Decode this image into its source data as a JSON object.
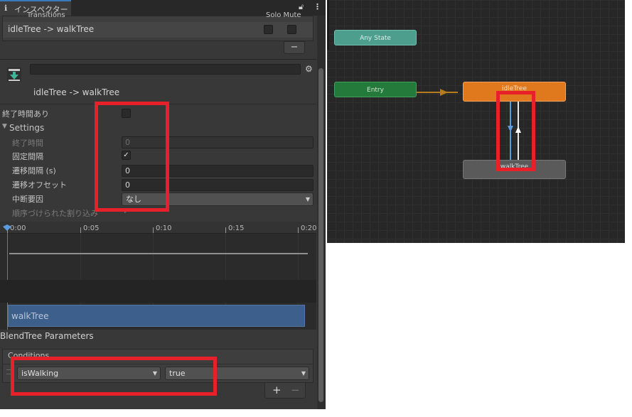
{
  "inspector": {
    "tab_label": "インスペクター",
    "header_partial_left": "Transitions",
    "header_partial_right": "Solo Mute",
    "transition_row": "idleTree -> walkTree",
    "remove_button": "−",
    "title": "idleTree -> walkTree",
    "has_exit_time_label": "終了時間あり",
    "settings_label": "Settings",
    "settings": {
      "exit_time_label": "終了時間",
      "exit_time_value": "0",
      "fixed_duration_label": "固定間隔",
      "duration_label": "遷移間隔 (s)",
      "duration_value": "0",
      "offset_label": "遷移オフセット",
      "offset_value": "0",
      "interruption_label": "中断要因",
      "interruption_value": "なし",
      "ordered_interruption_label": "順序づけられた割り込み"
    },
    "timeline": {
      "ticks": [
        "0:00",
        "0:05",
        "0:10",
        "0:15",
        "0:20"
      ],
      "bar_label": "walkTree"
    },
    "blendtree_label": "BlendTree Parameters",
    "conditions_label": "Conditions",
    "condition": {
      "parameter": "isWalking",
      "value": "true"
    },
    "add_button": "+",
    "minus_button": "−"
  },
  "graph": {
    "any_state": "Any State",
    "entry": "Entry",
    "idle_tree": "idleTree",
    "walk_tree": "walkTree"
  },
  "colors": {
    "highlight": "#e8202a",
    "accent_blue": "#3a79bb",
    "any_state": "#4e9e8e",
    "entry": "#237a3a",
    "idle_tree": "#e0791e",
    "walk_tree": "#5a5a5a"
  }
}
